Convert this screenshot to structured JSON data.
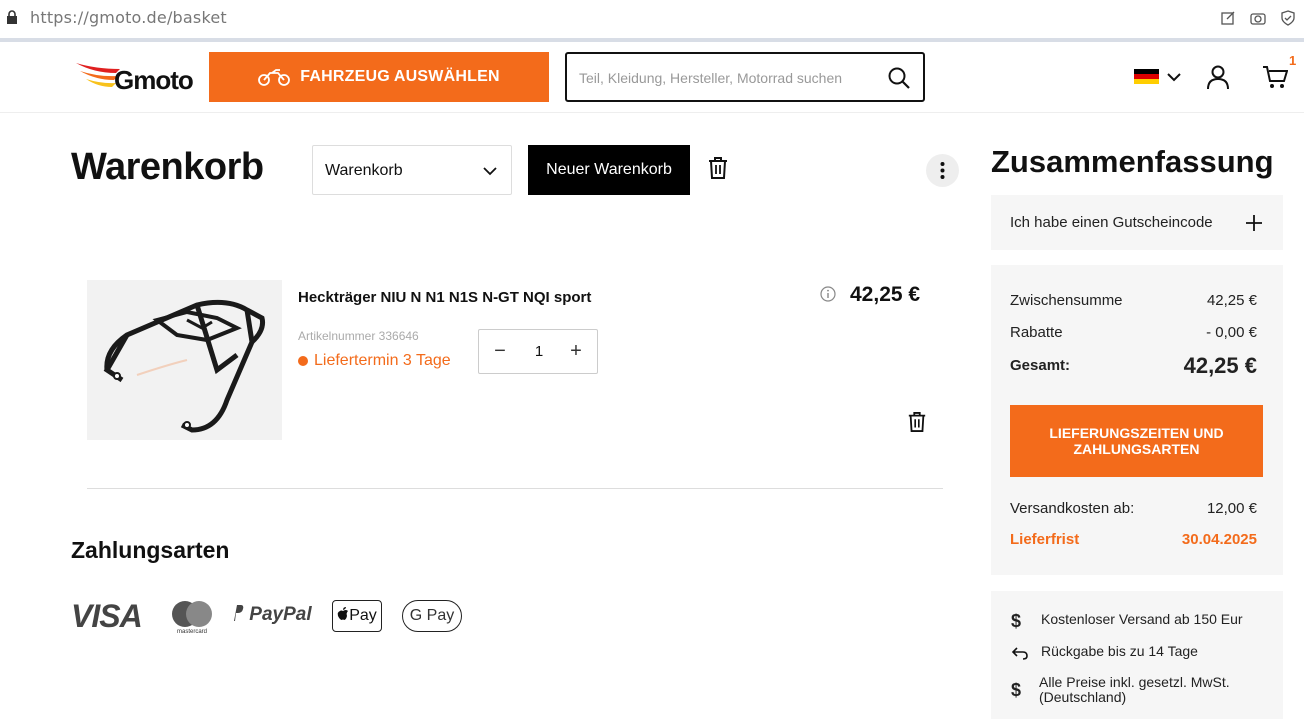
{
  "browser": {
    "url_host": "https://gmoto.de/",
    "url_path": "basket"
  },
  "header": {
    "logo_text": "Gmoto",
    "vehicle_button": "FAHRZEUG AUSWÄHLEN",
    "search_placeholder": "Teil, Kleidung, Hersteller, Motorrad suchen",
    "cart_count": "1"
  },
  "basket": {
    "title": "Warenkorb",
    "select_value": "Warenkorb",
    "new_basket_button": "Neuer Warenkorb"
  },
  "item": {
    "name": "Heckträger NIU N N1 N1S N-GT NQI sport",
    "article_number": "Artikelnummer 336646",
    "delivery": "Liefertermin 3 Tage",
    "quantity": "1",
    "price": "42,25 €"
  },
  "payment": {
    "title": "Zahlungsarten",
    "methods": [
      "VISA",
      "mastercard",
      "PayPal",
      "Pay",
      "G Pay"
    ]
  },
  "summary": {
    "title": "Zusammenfassung",
    "voucher": "Ich habe einen Gutscheincode",
    "subtotal_label": "Zwischensumme",
    "subtotal_value": "42,25 €",
    "discount_label": "Rabatte",
    "discount_value": "- 0,00 €",
    "total_label": "Gesamt:",
    "total_value": "42,25 €",
    "checkout_line1": "LIEFERUNGSZEITEN UND",
    "checkout_line2": "ZAHLUNGSARTEN",
    "shipping_label": "Versandkosten ab:",
    "shipping_value": "12,00 €",
    "delivery_label": "Lieferfrist",
    "delivery_value": "30.04.2025"
  },
  "perks": [
    "Kostenloser Versand ab 150 Eur",
    "Rückgabe bis zu 14 Tage",
    "Alle Preise inkl. gesetzl. MwSt.",
    "(Deutschland)"
  ],
  "colors": {
    "accent": "#f36b1b",
    "panel": "#f6f6f6"
  }
}
